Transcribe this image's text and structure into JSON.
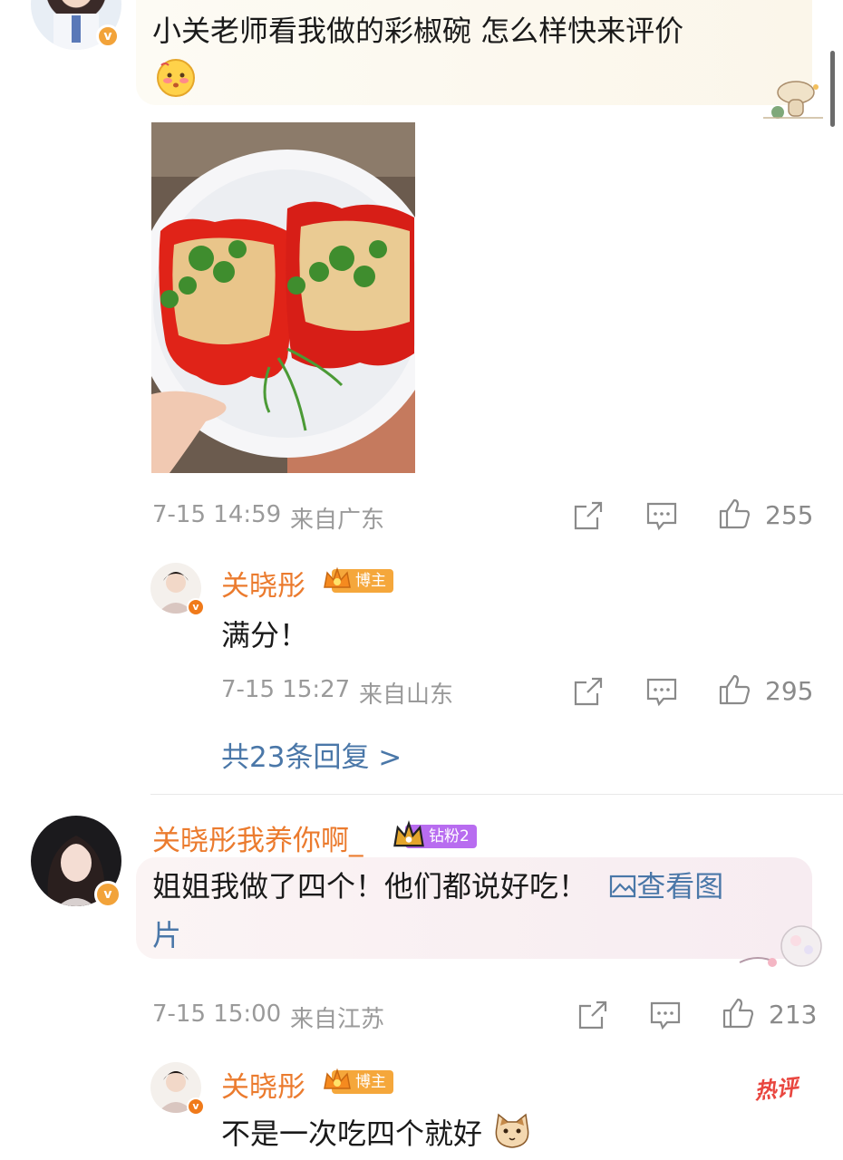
{
  "comments": [
    {
      "text_line1": "小关老师看我做的彩椒碗 怎么样快来评价",
      "time": "7-15 14:59",
      "location": "来自广东",
      "likes": "255",
      "reply": {
        "username": "关晓彤",
        "badge": "博主",
        "text": "满分！",
        "time": "7-15 15:27",
        "location": "来自山东",
        "likes": "295"
      },
      "more_replies": "共23条回复 >"
    },
    {
      "username": "关晓彤我养你啊_",
      "badge": "钻粉2",
      "text": "姐姐我做了四个！他们都说好吃！",
      "view_image": "查看图",
      "view_image_cont": "片",
      "time": "7-15 15:00",
      "location": "来自江苏",
      "likes": "213",
      "reply": {
        "username": "关晓彤",
        "badge": "博主",
        "text": "不是一次吃四个就好",
        "hot_label": "热评"
      }
    }
  ],
  "colors": {
    "username": "#eb7b2e",
    "link": "#4a77a8",
    "meta": "#9a9a9a"
  }
}
